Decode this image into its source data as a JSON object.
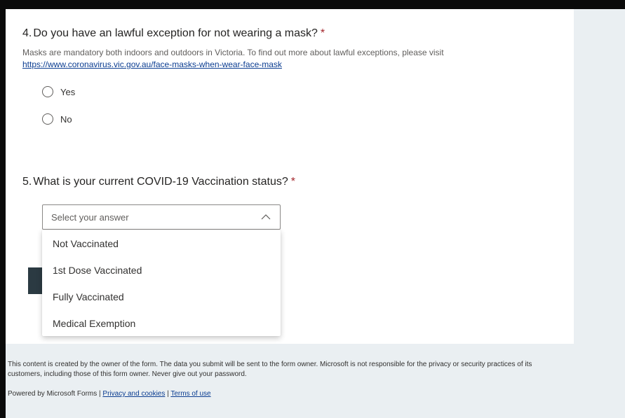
{
  "question4": {
    "number": "4.",
    "title": "Do you have an lawful exception for not wearing a mask?",
    "required_mark": "*",
    "description_text": "Masks are mandatory both indoors and outdoors in Victoria. To find out more about lawful exceptions, please visit ",
    "description_link": "https://www.coronavirus.vic.gov.au/face-masks-when-wear-face-mask",
    "options": [
      "Yes",
      "No"
    ]
  },
  "question5": {
    "number": "5.",
    "title": "What is your current COVID-19 Vaccination status?",
    "required_mark": "*",
    "placeholder": "Select your answer",
    "options": [
      "Not Vaccinated",
      "1st Dose Vaccinated",
      "Fully Vaccinated",
      "Medical Exemption"
    ]
  },
  "footer": {
    "disclaimer": "This content is created by the owner of the form. The data you submit will be sent to the form owner. Microsoft is not responsible for the privacy or security practices of its customers, including those of this form owner. Never give out your password.",
    "powered_by": "Powered by Microsoft Forms | ",
    "privacy_link": "Privacy and cookies",
    "separator": " | ",
    "terms_link": "Terms of use"
  },
  "colors": {
    "required": "#a4262c",
    "link": "#0b3d91",
    "page_background": "#eaeff2",
    "submit_button": "#2b3a42"
  }
}
